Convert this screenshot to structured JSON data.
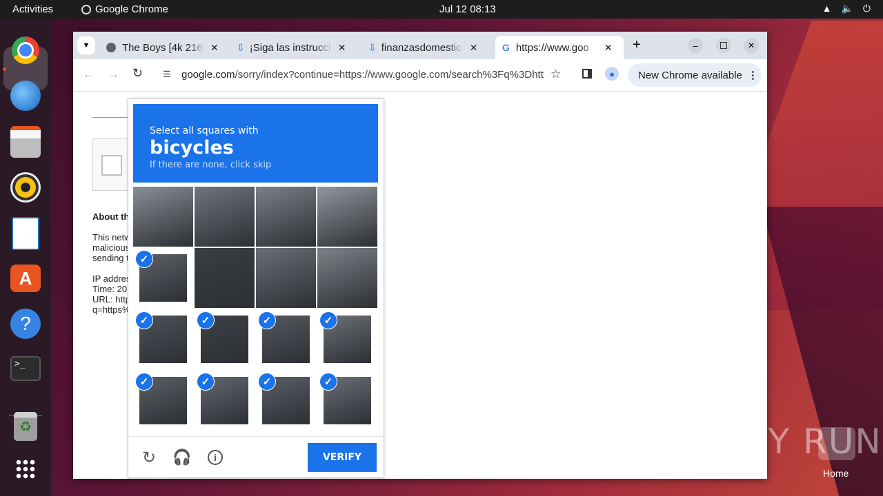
{
  "topbar": {
    "activities": "Activities",
    "app_name": "Google Chrome",
    "clock": "Jul 12  08:13"
  },
  "dock": {
    "items": [
      "chrome",
      "thunderbird",
      "files",
      "rhythmbox",
      "writer",
      "software",
      "help",
      "terminal",
      "trash",
      "apps"
    ]
  },
  "browser": {
    "tabs": [
      {
        "title": "The Boys [4k 2160",
        "icon": "globe-icon"
      },
      {
        "title": "¡Siga las instrucci",
        "icon": "download-icon"
      },
      {
        "title": "finanzasdomestic",
        "icon": "download-icon"
      },
      {
        "title": "https://www.goo",
        "icon": "google-icon",
        "active": true
      }
    ],
    "url_host": "google.com",
    "url_rest": "/sorry/index?continue=https://www.google.com/search%3Fq%3Dhtt...",
    "new_chrome": "New Chrome available"
  },
  "page": {
    "about": "About th",
    "lines1": [
      "This netw",
      "malicious",
      "sending t"
    ],
    "lines2": [
      "IP addres",
      "Time: 20",
      "URL: http",
      "q=https%"
    ]
  },
  "captcha": {
    "line1": "Select all squares with",
    "object": "bicycles",
    "line3": "If there are none, click skip",
    "verify": "VERIFY",
    "selected": [
      4,
      8,
      9,
      10,
      11,
      12,
      13,
      14,
      15
    ]
  },
  "watermark": "ANY RUN",
  "desktop": {
    "home": "Home"
  }
}
